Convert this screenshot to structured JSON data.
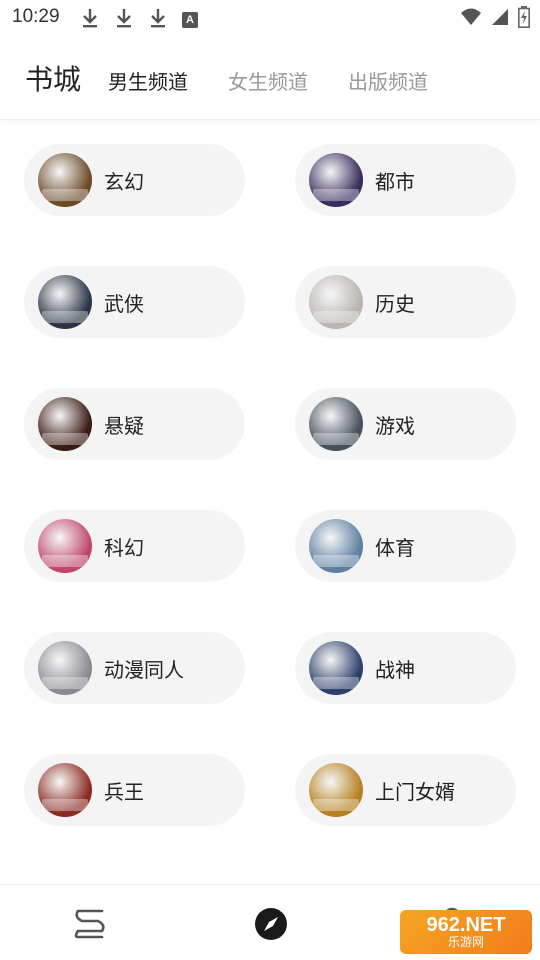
{
  "status_bar": {
    "time": "10:29",
    "left_icons": [
      "download-icon",
      "download-icon",
      "download-icon",
      "a-icon"
    ],
    "a_icon_letter": "A",
    "right_icons": [
      "wifi-icon",
      "cellular-signal-icon",
      "battery-charging-icon"
    ]
  },
  "header": {
    "title": "书城",
    "tabs": [
      {
        "label": "男生频道",
        "active": true
      },
      {
        "label": "女生频道",
        "active": false
      },
      {
        "label": "出版频道",
        "active": false
      }
    ]
  },
  "categories": [
    {
      "label": "玄幻",
      "cover_color": "#6b4a2a"
    },
    {
      "label": "都市",
      "cover_color": "#3a2d5c"
    },
    {
      "label": "武侠",
      "cover_color": "#2b3446"
    },
    {
      "label": "历史",
      "cover_color": "#b8b4ae"
    },
    {
      "label": "悬疑",
      "cover_color": "#3a1a14"
    },
    {
      "label": "游戏",
      "cover_color": "#46505a"
    },
    {
      "label": "科幻",
      "cover_color": "#c0476a"
    },
    {
      "label": "体育",
      "cover_color": "#5e7fa0"
    },
    {
      "label": "动漫同人",
      "cover_color": "#8a8a92"
    },
    {
      "label": "战神",
      "cover_color": "#2d3f6b"
    },
    {
      "label": "兵王",
      "cover_color": "#8c2a22"
    },
    {
      "label": "上门女婿",
      "cover_color": "#b7801f"
    }
  ],
  "bottom_nav": {
    "items": [
      {
        "icon": "bookshelf-icon",
        "active": false
      },
      {
        "icon": "compass-icon",
        "active": true
      },
      {
        "icon": "profile-icon",
        "active": false
      }
    ]
  },
  "watermark": {
    "top": "962.NET",
    "bottom": "乐游网"
  }
}
